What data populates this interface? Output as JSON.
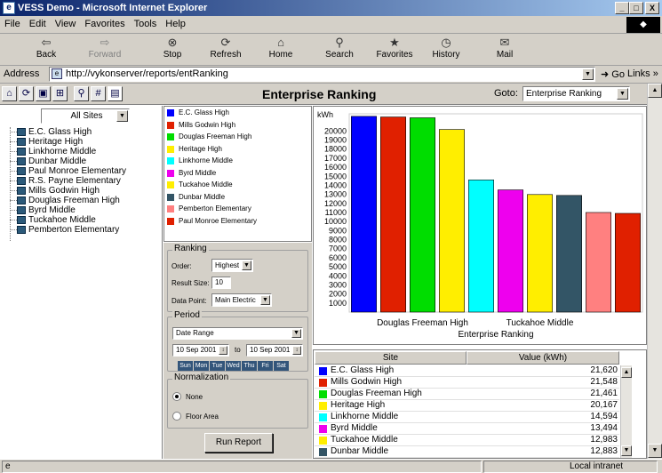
{
  "window": {
    "title": "VESS Demo - Microsoft Internet Explorer",
    "min": "_",
    "max": "□",
    "close": "X"
  },
  "menu": [
    "File",
    "Edit",
    "View",
    "Favorites",
    "Tools",
    "Help"
  ],
  "toolbar": {
    "back": "Back",
    "forward": "Forward",
    "stop": "Stop",
    "refresh": "Refresh",
    "home": "Home",
    "search": "Search",
    "favorites": "Favorites",
    "history": "History",
    "mail": "Mail"
  },
  "address": {
    "label": "Address",
    "url": "http://vykonserver/reports/entRanking",
    "go": "Go",
    "links": "Links"
  },
  "app": {
    "title": "Enterprise Ranking",
    "goto_label": "Goto:",
    "goto_value": "Enterprise Ranking"
  },
  "sidebar": {
    "filter": "All Sites",
    "sites": [
      "E.C. Glass High",
      "Heritage High",
      "Linkhorne Middle",
      "Dunbar Middle",
      "Paul Monroe Elementary",
      "R.S. Payne Elementary",
      "Mills Godwin High",
      "Douglas Freeman High",
      "Byrd Middle",
      "Tuckahoe Middle",
      "Pemberton Elementary"
    ]
  },
  "legend": [
    {
      "name": "E.C. Glass High",
      "color": "#0000ff"
    },
    {
      "name": "Mills Godwin High",
      "color": "#e02000"
    },
    {
      "name": "Douglas Freeman High",
      "color": "#00dd00"
    },
    {
      "name": "Heritage High",
      "color": "#ffee00"
    },
    {
      "name": "Linkhorne Middle",
      "color": "#00ffff"
    },
    {
      "name": "Byrd Middle",
      "color": "#ee00ee"
    },
    {
      "name": "Tuckahoe Middle",
      "color": "#ffee00"
    },
    {
      "name": "Dunbar Middle",
      "color": "#335566"
    },
    {
      "name": "Pemberton Elementary",
      "color": "#ff8080"
    },
    {
      "name": "Paul Monroe Elementary",
      "color": "#e02000"
    }
  ],
  "ranking": {
    "legend": "Ranking",
    "order_label": "Order:",
    "order_value": "Highest",
    "size_label": "Result Size:",
    "size_value": "10",
    "point_label": "Data Point:",
    "point_value": "Main Electric"
  },
  "period": {
    "legend": "Period",
    "mode": "Date Range",
    "from": "10 Sep 2001",
    "to_label": "to",
    "to": "10 Sep 2001",
    "days": [
      "Sun",
      "Mon",
      "Tue",
      "Wed",
      "Thu",
      "Fri",
      "Sat"
    ]
  },
  "normalization": {
    "legend": "Normalization",
    "none": "None",
    "floor": "Floor Area"
  },
  "run_button": "Run Report",
  "chart_data": {
    "type": "bar",
    "ylabel": "kWh",
    "xlabel": "Enterprise Ranking",
    "categories": [
      "E.C. Glass High",
      "Mills Godwin High",
      "Douglas Freeman High",
      "Heritage High",
      "Linkhorne Middle",
      "Byrd Middle",
      "Tuckahoe Middle",
      "Dunbar Middle",
      "Pemberton Elementary",
      "Paul Monroe Elementary"
    ],
    "values": [
      21620,
      21548,
      21461,
      20167,
      14594,
      13494,
      12983,
      12883,
      11000,
      10900
    ],
    "colors": [
      "#0000ff",
      "#e02000",
      "#00dd00",
      "#ffee00",
      "#00ffff",
      "#ee00ee",
      "#ffee00",
      "#335566",
      "#ff8080",
      "#e02000"
    ],
    "yticks": [
      1000,
      2000,
      3000,
      4000,
      5000,
      6000,
      7000,
      8000,
      9000,
      10000,
      11000,
      12000,
      13000,
      14000,
      15000,
      16000,
      17000,
      18000,
      19000,
      20000
    ],
    "ylim": [
      0,
      21900
    ],
    "xticklabels": [
      "Douglas Freeman High",
      "Tuckahoe Middle"
    ],
    "xtick_index": [
      2,
      6
    ]
  },
  "table": {
    "headers": [
      "Site",
      "Value (kWh)"
    ],
    "rows": [
      {
        "site": "E.C. Glass High",
        "value": "21,620",
        "color": "#0000ff"
      },
      {
        "site": "Mills Godwin High",
        "value": "21,548",
        "color": "#e02000"
      },
      {
        "site": "Douglas Freeman High",
        "value": "21,461",
        "color": "#00dd00"
      },
      {
        "site": "Heritage High",
        "value": "20,167",
        "color": "#ffee00"
      },
      {
        "site": "Linkhorne Middle",
        "value": "14,594",
        "color": "#00ffff"
      },
      {
        "site": "Byrd Middle",
        "value": "13,494",
        "color": "#ee00ee"
      },
      {
        "site": "Tuckahoe Middle",
        "value": "12,983",
        "color": "#ffee00"
      },
      {
        "site": "Dunbar Middle",
        "value": "12,883",
        "color": "#335566"
      }
    ]
  },
  "status": {
    "zone": "Local intranet"
  }
}
